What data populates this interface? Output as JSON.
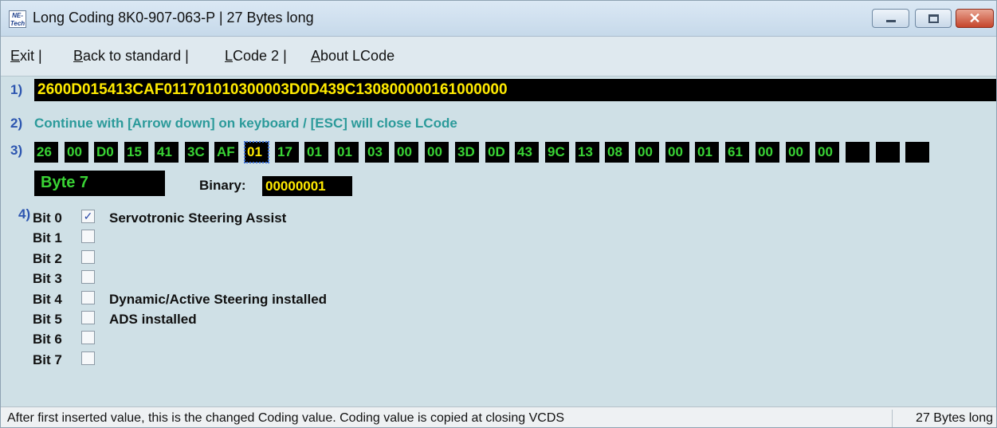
{
  "window": {
    "icon_text": "NE-Tech",
    "title": "Long Coding  8K0-907-063-P | 27 Bytes long"
  },
  "menu": [
    {
      "key": "E",
      "rest": "xit",
      "suffix": " |"
    },
    {
      "key": "B",
      "rest": "ack to standard",
      "suffix": " |"
    },
    {
      "key": "L",
      "rest": "Code 2",
      "suffix": " |"
    },
    {
      "key": "A",
      "rest": "bout LCode",
      "suffix": ""
    }
  ],
  "steps": {
    "s1": "1)",
    "s2": "2)",
    "s3": "3)",
    "s4": "4)"
  },
  "coding_value": "2600D015413CAF011701010300003D0D439C130800000161000000",
  "hint": "Continue with [Arrow down] on keyboard / [ESC] will close LCode",
  "bytes": [
    "26",
    "00",
    "D0",
    "15",
    "41",
    "3C",
    "AF",
    "01",
    "17",
    "01",
    "01",
    "03",
    "00",
    "00",
    "3D",
    "0D",
    "43",
    "9C",
    "13",
    "08",
    "00",
    "00",
    "01",
    "61",
    "00",
    "00",
    "00",
    "",
    "",
    ""
  ],
  "selected_byte_index": 7,
  "byte_label": "Byte 7",
  "binary_label": "Binary:",
  "binary_value": "00000001",
  "bits": [
    {
      "label": "Bit 0",
      "checked": true,
      "desc": "Servotronic Steering Assist"
    },
    {
      "label": "Bit 1",
      "checked": false,
      "desc": ""
    },
    {
      "label": "Bit 2",
      "checked": false,
      "desc": ""
    },
    {
      "label": "Bit 3",
      "checked": false,
      "desc": ""
    },
    {
      "label": "Bit 4",
      "checked": false,
      "desc": "Dynamic/Active Steering installed"
    },
    {
      "label": "Bit 5",
      "checked": false,
      "desc": "ADS installed"
    },
    {
      "label": "Bit 6",
      "checked": false,
      "desc": ""
    },
    {
      "label": "Bit 7",
      "checked": false,
      "desc": ""
    }
  ],
  "status": {
    "left": "After first inserted value, this is the changed Coding value.  Coding value is copied at closing VCDS",
    "right": "27 Bytes long"
  },
  "colors": {
    "field_bg": "#000000",
    "byte_text": "#39d334",
    "coding_text": "#ffea00",
    "hint_text": "#2b9a9a",
    "step_number": "#2d56b0",
    "panel_bg": "#cfe0e6"
  }
}
